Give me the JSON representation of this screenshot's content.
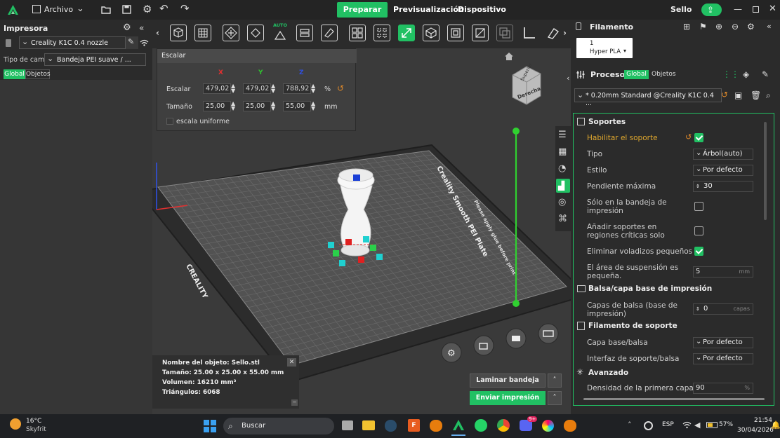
{
  "topbar": {
    "app_menu": "Archivo",
    "tabs": [
      "Preparar",
      "Previsualización",
      "Dispositivo"
    ],
    "active_tab": "Preparar",
    "project_name": "Sello"
  },
  "printer": {
    "header": "Impresora",
    "name": "Creality K1C 0.4 nozzle",
    "bed_label": "Tipo de cama",
    "bed_value": "Bandeja PEI suave / ...",
    "tab_global": "Global",
    "tab_objects": "Objetos"
  },
  "scale_popup": {
    "title": "Escalar",
    "axis_labels": [
      "X",
      "Y",
      "Z"
    ],
    "scale_label": "Escalar",
    "scale_values": [
      "479,02",
      "479,02",
      "788,92"
    ],
    "scale_unit": "%",
    "size_label": "Tamaño",
    "size_values": [
      "25,00",
      "25,00",
      "55,00"
    ],
    "size_unit": "mm",
    "uniform_label": "escala uniforme"
  },
  "tools": {
    "auto_label": "AUTO"
  },
  "viewcube": {
    "top": "Superior",
    "right": "Derecha"
  },
  "plate": {
    "brand": "Creality Smooth PEI Plate",
    "logo": "CREALITY",
    "side_text": "Please apply glue before print"
  },
  "object_info": {
    "name": "Nombre del objeto: Sello.stl",
    "size": "Tamaño: 25.00 x 25.00 x 55.00 mm",
    "volume": "Volumen: 16210 mm³",
    "triangles": "Triángulos: 6068"
  },
  "actions": {
    "slice": "Laminar bandeja",
    "send": "Enviar impresión"
  },
  "filament": {
    "header": "Filamento",
    "slot": "1",
    "material": "Hyper PLA"
  },
  "process": {
    "header": "Proceso",
    "tab_global": "Global",
    "tab_objects": "Objetos",
    "preset": "* 0.20mm Standard @Creality K1C 0.4 ..."
  },
  "settings": {
    "supports_title": "Soportes",
    "enable_support": "Habilitar el soporte",
    "type_label": "Tipo",
    "type_value": "Árbol(auto)",
    "style_label": "Estilo",
    "style_value": "Por defecto",
    "slope_label": "Pendiente máxima",
    "slope_value": "30",
    "build_plate_only": "Sólo en la bandeja de impresión",
    "critical_regions": "Añadir soportes en regiones críticas solo",
    "remove_small": "Eliminar voladizos pequeños",
    "suspension_label": "El área de suspensión es pequeña.",
    "suspension_value": "5",
    "suspension_unit": "mm",
    "raft_title": "Balsa/capa base de impresión",
    "raft_layers_label": "Capas de balsa (base de impresión)",
    "raft_layers_value": "0",
    "raft_layers_unit": "capas",
    "support_filament_title": "Filamento de soporte",
    "base_raft_label": "Capa base/balsa",
    "base_raft_value": "Por defecto",
    "interface_label": "Interfaz de soporte/balsa",
    "interface_value": "Por defecto",
    "advanced_title": "Avanzado",
    "first_layer_density_label": "Densidad de la primera capa",
    "first_layer_density_value": "90",
    "first_layer_density_unit": "%"
  },
  "taskbar": {
    "temperature": "16°C",
    "weather": "Skyfrit",
    "search": "Buscar",
    "lang": "ESP",
    "battery": "57%",
    "time": "21:54",
    "date": "30/04/2026",
    "badge": "9+",
    "files_badge": "F"
  },
  "colors": {
    "accent": "#21c063",
    "panel": "#2b2b2b",
    "viewport": "#3a3a3a",
    "x_axis": "#e03030",
    "y_axis": "#30d030",
    "z_axis": "#3050e0"
  }
}
